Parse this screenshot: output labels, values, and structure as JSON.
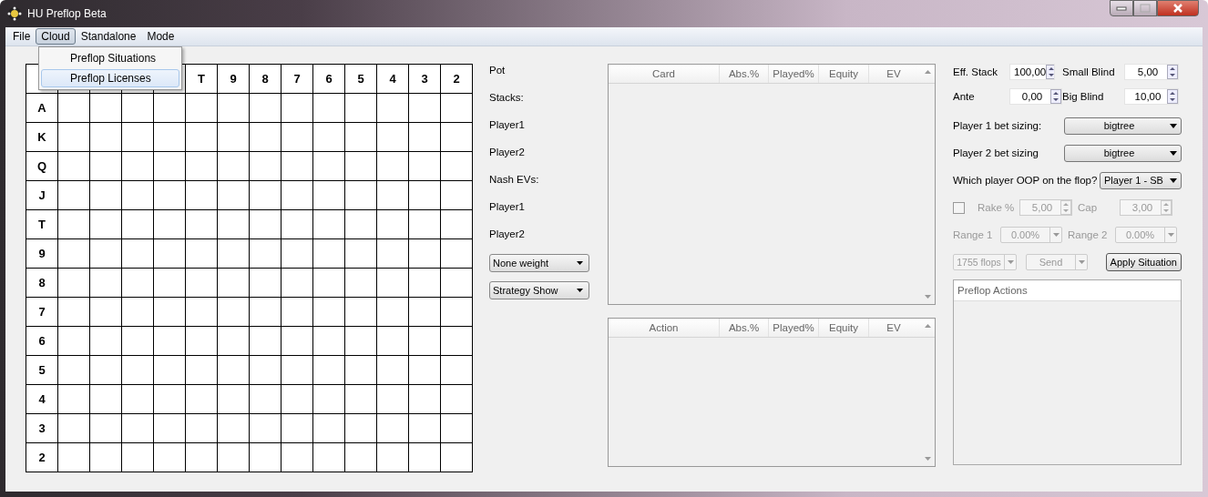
{
  "window": {
    "title": "HU Preflop Beta"
  },
  "menu": [
    {
      "label": "File",
      "selected": false
    },
    {
      "label": "Cloud",
      "selected": true
    },
    {
      "label": "Standalone",
      "selected": false
    },
    {
      "label": "Mode",
      "selected": false
    }
  ],
  "open_menu": {
    "items": [
      {
        "label": "Preflop Situations",
        "selected": false
      },
      {
        "label": "Preflop Licenses",
        "selected": true
      }
    ]
  },
  "grid": {
    "column_headers": [
      "T",
      "9",
      "8",
      "7",
      "6",
      "5",
      "4",
      "3",
      "2"
    ],
    "row_headers": [
      "A",
      "K",
      "Q",
      "J",
      "T",
      "9",
      "8",
      "7",
      "6",
      "5",
      "4",
      "3",
      "2"
    ]
  },
  "info_labels": [
    "Pot",
    "Stacks:",
    "Player1",
    "Player2",
    "Nash EVs:",
    "Player1",
    "Player2"
  ],
  "view_selects": [
    "None weight",
    "Strategy Show"
  ],
  "card_table": {
    "columns": [
      "Card",
      "Abs.%",
      "Played%",
      "Equity",
      "EV"
    ]
  },
  "action_table": {
    "columns": [
      "Action",
      "Abs.%",
      "Played%",
      "Equity",
      "EV"
    ]
  },
  "settings": {
    "spins": [
      {
        "label": "Eff. Stack",
        "value": "100,00"
      },
      {
        "label": "Small Blind",
        "value": "5,00"
      },
      {
        "label": "Ante",
        "value": "0,00"
      },
      {
        "label": "Big Blind",
        "value": "10,00"
      }
    ],
    "sizings": [
      {
        "label": "Player 1 bet sizing:",
        "value": "bigtree"
      },
      {
        "label": "Player 2 bet sizing",
        "value": "bigtree"
      }
    ],
    "oop": {
      "label": "Which player OOP on the flop?",
      "value": "Player 1 - SB"
    },
    "rake": {
      "checked": false,
      "label": "Rake %",
      "value": "5,00",
      "cap_label": "Cap",
      "cap_value": "3,00",
      "disabled": true
    },
    "ranges": [
      {
        "label": "Range 1",
        "value": "0.00%",
        "disabled": true
      },
      {
        "label": "Range 2",
        "value": "0.00%",
        "disabled": true
      }
    ],
    "flops": {
      "value": "1755 flops",
      "disabled": true
    },
    "send": {
      "value": "Send",
      "disabled": true
    },
    "apply_button": "Apply Situation",
    "actions_panel": {
      "title": "Preflop Actions"
    }
  }
}
